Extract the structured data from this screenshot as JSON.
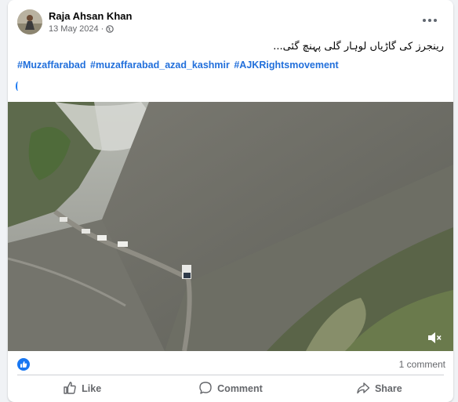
{
  "post": {
    "author": "Raja Ahsan Khan",
    "date": "13 May 2024",
    "separator": "·",
    "privacy_icon": "globe-icon",
    "more_icon": "more-options-icon",
    "text_urdu": "رینجرز کی گاڑیاں لوہار گلی پہنچ گئی...",
    "hashtags": [
      "#Muzaffarabad",
      "#muzaffarabad_azad_kashmir",
      "#AJKRightsmovement"
    ]
  },
  "video": {
    "sound_icon": "volume-muted-icon"
  },
  "reactions": {
    "icon": "like-reaction-icon",
    "comments_label": "1 comment"
  },
  "actions": {
    "like_label": "Like",
    "comment_label": "Comment",
    "share_label": "Share"
  },
  "colors": {
    "link": "#216fdb",
    "brand": "#1877f2",
    "secondary_text": "#65676b"
  }
}
